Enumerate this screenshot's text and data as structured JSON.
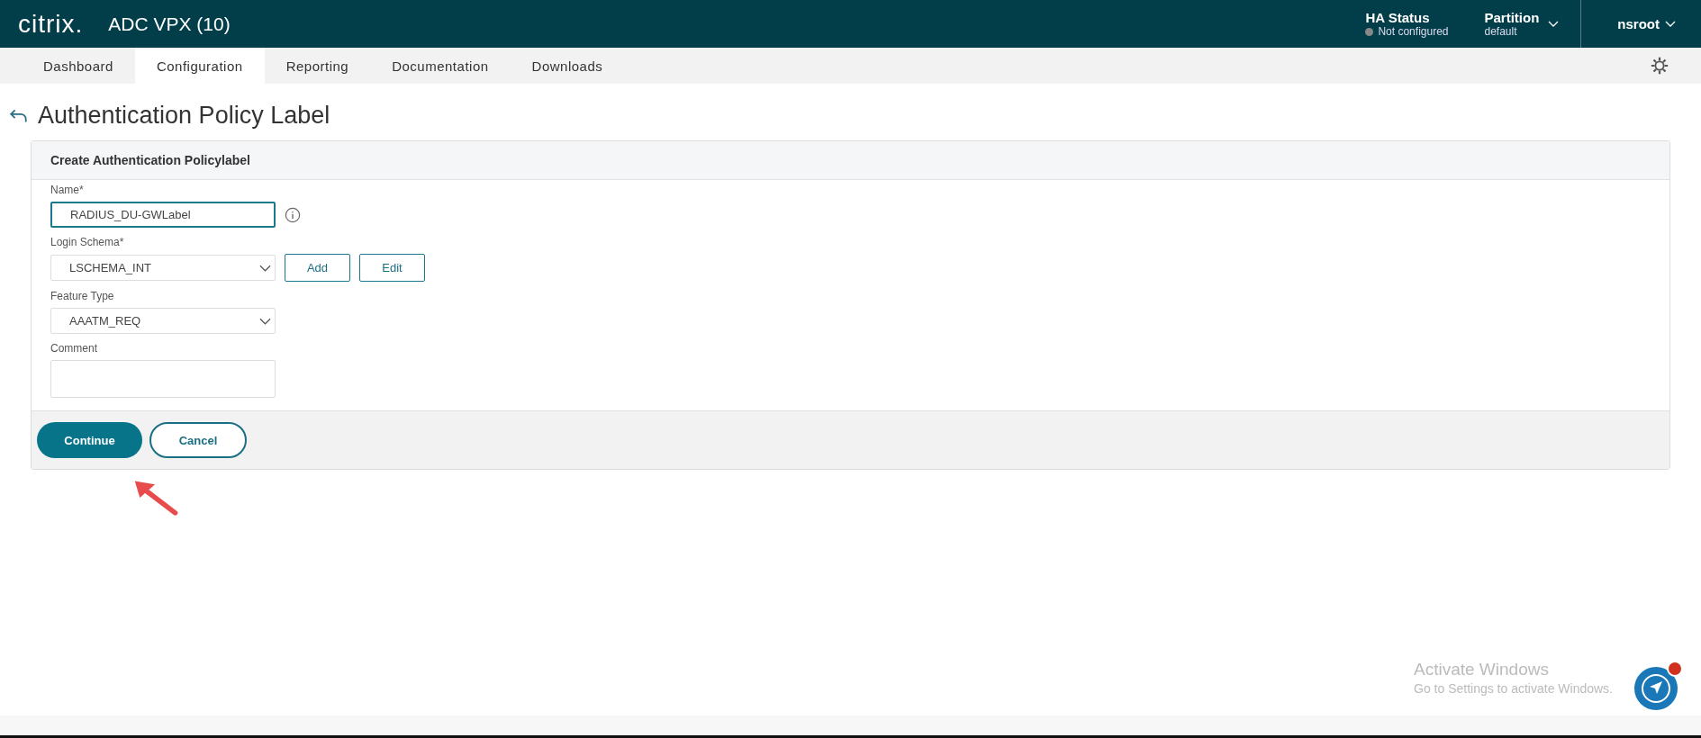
{
  "header": {
    "logo": "citrix.",
    "product": "ADC VPX (10)",
    "ha_status": {
      "title": "HA Status",
      "value": "Not configured"
    },
    "partition": {
      "title": "Partition",
      "value": "default"
    },
    "user": "nsroot"
  },
  "tabs": [
    {
      "label": "Dashboard",
      "selected": false
    },
    {
      "label": "Configuration",
      "selected": true
    },
    {
      "label": "Reporting",
      "selected": false
    },
    {
      "label": "Documentation",
      "selected": false
    },
    {
      "label": "Downloads",
      "selected": false
    }
  ],
  "page_title": "Authentication Policy Label",
  "form": {
    "title": "Create Authentication Policylabel",
    "fields": [
      {
        "kind": "text",
        "label": "Name*",
        "value": "RADIUS_DU-GWLabel",
        "focused": true,
        "info": true
      },
      {
        "kind": "select",
        "label": "Login Schema*",
        "value": "LSCHEMA_INT",
        "focused": false,
        "buttons": [
          "Add",
          "Edit"
        ]
      },
      {
        "kind": "select",
        "label": "Feature Type",
        "value": "AAATM_REQ",
        "focused": false
      },
      {
        "kind": "textarea",
        "label": "Comment",
        "focused": false
      }
    ],
    "actions": [
      {
        "label": "Continue",
        "kind": "primary"
      },
      {
        "label": "Cancel",
        "kind": "secondary"
      }
    ]
  },
  "activation_notice": {
    "title": "Activate Windows",
    "text": "Go to Settings to activate Windows."
  }
}
